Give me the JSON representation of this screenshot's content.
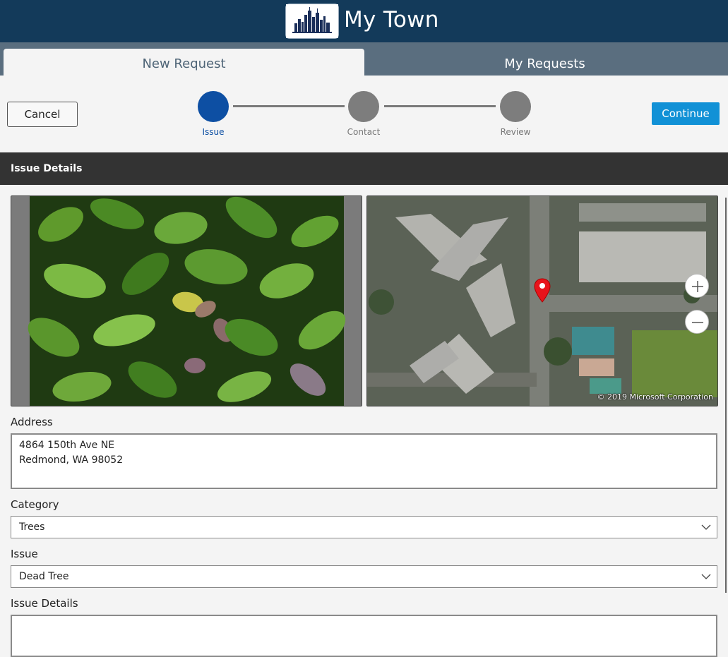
{
  "header": {
    "app_title": "My Town",
    "logo_icon": "city-skyline-icon"
  },
  "tabs": [
    {
      "label": "New Request",
      "selected": true
    },
    {
      "label": "My Requests",
      "selected": false
    }
  ],
  "toolbar": {
    "cancel_label": "Cancel",
    "continue_label": "Continue"
  },
  "steps": [
    {
      "label": "Issue",
      "active": true
    },
    {
      "label": "Contact",
      "active": false
    },
    {
      "label": "Review",
      "active": false
    }
  ],
  "section": {
    "title": "Issue Details"
  },
  "map": {
    "copyright": "© 2019 Microsoft Corporation",
    "pin_icon": "map-pin-icon",
    "zoom_in_icon": "plus-icon",
    "zoom_out_icon": "minus-icon"
  },
  "form": {
    "address_label": "Address",
    "address_line1": "4864 150th Ave NE",
    "address_line2": "Redmond, WA 98052",
    "category_label": "Category",
    "category_value": "Trees",
    "issue_label": "Issue",
    "issue_value": "Dead Tree",
    "details_label": "Issue Details",
    "details_value": ""
  },
  "colors": {
    "header": "#133a5a",
    "tabbar": "#5a6e7f",
    "accent": "#1191d6",
    "step_active": "#0d4fa3",
    "section_bar": "#333333"
  }
}
